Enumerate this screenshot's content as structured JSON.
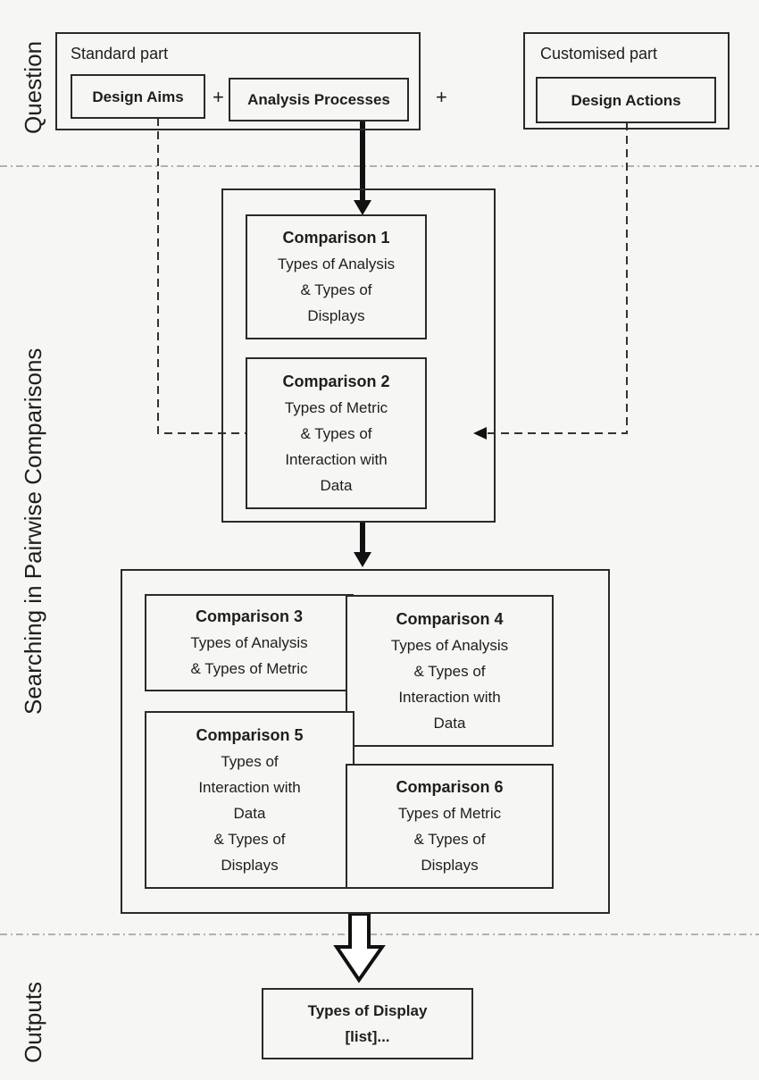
{
  "sections": {
    "question": "Question",
    "search": "Searching in Pairwise Comparisons",
    "outputs": "Outputs"
  },
  "question": {
    "standard_label": "Standard part",
    "customised_label": "Customised part",
    "design_aims": "Design Aims",
    "analysis_processes": "Analysis Processes",
    "design_actions": "Design Actions",
    "plus": "+"
  },
  "comparisons": [
    {
      "title": "Comparison 1",
      "lines": [
        "Types of Analysis",
        "& Types of",
        "Displays"
      ]
    },
    {
      "title": "Comparison 2",
      "lines": [
        "Types of Metric",
        "& Types of",
        "Interaction with",
        "Data"
      ]
    },
    {
      "title": "Comparison 3",
      "lines": [
        "Types of Analysis",
        "& Types of Metric"
      ]
    },
    {
      "title": "Comparison 4",
      "lines": [
        "Types of Analysis",
        "& Types of",
        "Interaction with",
        "Data"
      ]
    },
    {
      "title": "Comparison 5",
      "lines": [
        "Types of",
        "Interaction with",
        "Data",
        "& Types of",
        "Displays"
      ]
    },
    {
      "title": "Comparison 6",
      "lines": [
        "Types of Metric",
        "& Types of",
        "Displays"
      ]
    }
  ],
  "output": {
    "line1": "Types of Display",
    "line2": "[list]..."
  }
}
